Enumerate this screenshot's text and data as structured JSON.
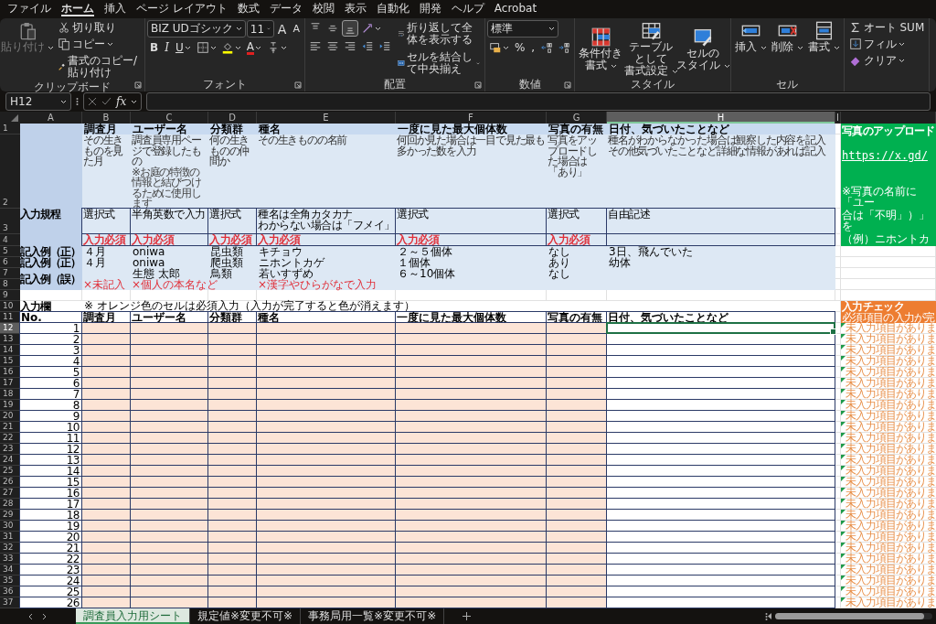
{
  "menu": [
    {
      "label": "ファイル",
      "selected": false
    },
    {
      "label": "ホーム",
      "selected": true
    },
    {
      "label": "挿入",
      "selected": false
    },
    {
      "label": "ページ レイアウト",
      "selected": false
    },
    {
      "label": "数式",
      "selected": false
    },
    {
      "label": "データ",
      "selected": false
    },
    {
      "label": "校閲",
      "selected": false
    },
    {
      "label": "表示",
      "selected": false
    },
    {
      "label": "自動化",
      "selected": false
    },
    {
      "label": "開発",
      "selected": false
    },
    {
      "label": "ヘルプ",
      "selected": false
    },
    {
      "label": "Acrobat",
      "selected": false
    }
  ],
  "ribbon": {
    "groups": [
      {
        "label": "クリップボード",
        "launcher": true,
        "blocks": [
          [
            [
              {
                "kind": "large",
                "lines": [
                  "貼り付け"
                ],
                "disabled": true,
                "menu": true
              }
            ]
          ],
          [
            [
              {
                "kind": "small",
                "label": "切り取り"
              }
            ],
            [
              {
                "kind": "small",
                "label": "コピー",
                "menu": true
              }
            ],
            [
              {
                "kind": "small",
                "label": "書式のコピー/貼り付け"
              }
            ]
          ]
        ]
      },
      {
        "label": "フォント",
        "launcher": true,
        "blocks": [
          [
            [
              {
                "kind": "wide_field",
                "value": "BIZ UDゴシック",
                "menu": true
              },
              {
                "kind": "narrow_field",
                "value": "11",
                "menu": true
              },
              {
                "kind": "grow",
                "label": "A"
              },
              {
                "kind": "shrink",
                "label": "A"
              }
            ],
            [
              {
                "kind": "bold",
                "label": "B"
              },
              {
                "kind": "italic",
                "label": "I"
              },
              {
                "kind": "underline",
                "label": "U",
                "menu": true
              },
              {
                "kind": "icon",
                "menu": true
              },
              {
                "kind": "icon",
                "menu": true
              },
              {
                "kind": "font_color",
                "label": "A",
                "menu": true
              },
              {
                "kind": "icon",
                "menu": true
              }
            ]
          ]
        ]
      },
      {
        "label": "配置",
        "launcher": true,
        "blocks": [
          [
            [
              {
                "kind": "icon",
                "selected": false
              },
              {
                "kind": "icon",
                "selected": false
              },
              {
                "kind": "icon",
                "selected": true
              },
              {
                "kind": "icon",
                "menu": true,
                "selected": false
              }
            ],
            [
              {
                "kind": "icon",
                "selected": false
              },
              {
                "kind": "icon",
                "selected": false
              },
              {
                "kind": "icon",
                "selected": false
              },
              {
                "kind": "icon",
                "selected": false
              },
              {
                "kind": "icon",
                "selected": false
              }
            ]
          ],
          [
            [
              {
                "kind": "small",
                "label": "折り返して全体を表示する"
              }
            ],
            [
              {
                "kind": "small",
                "label": "セルを結合して中央揃え",
                "menu": true
              }
            ]
          ]
        ]
      },
      {
        "label": "数値",
        "launcher": true,
        "blocks": [
          [
            [
              {
                "kind": "wide_field",
                "value": "標準",
                "menu": true
              }
            ],
            [
              {
                "kind": "icon",
                "menu": true
              },
              {
                "kind": "glyph",
                "label": "%"
              },
              {
                "kind": "glyph",
                "label": ","
              },
              {
                "kind": "icon"
              },
              {
                "kind": "icon"
              }
            ]
          ]
        ]
      },
      {
        "label": "スタイル",
        "blocks": [
          [
            [
              {
                "kind": "large",
                "lines": [
                  "条件付き",
                  "書式"
                ],
                "menu": true
              },
              {
                "kind": "large",
                "lines": [
                  "テーブルとして",
                  "書式設定"
                ],
                "menu": true
              },
              {
                "kind": "large",
                "lines": [
                  "セルの",
                  "スタイル"
                ],
                "menu": true
              }
            ]
          ]
        ]
      },
      {
        "label": "セル",
        "blocks": [
          [
            [
              {
                "kind": "large",
                "lines": [
                  "挿入"
                ],
                "menu": true
              },
              {
                "kind": "large",
                "lines": [
                  "削除"
                ],
                "menu": true
              },
              {
                "kind": "large",
                "lines": [
                  "書式"
                ],
                "menu": true
              }
            ]
          ]
        ]
      },
      {
        "blocks": [
          [
            [
              {
                "kind": "small",
                "label": "オート SUM"
              }
            ],
            [
              {
                "kind": "small",
                "label": "フィル",
                "menu": true
              }
            ],
            [
              {
                "kind": "small",
                "label": "クリア",
                "menu": true
              }
            ]
          ]
        ]
      }
    ]
  },
  "formula_bar": {
    "name_box": "H12",
    "fx": "fx"
  },
  "sheet": {
    "columns": [
      {
        "letter": "A",
        "selected": false
      },
      {
        "letter": "B",
        "selected": false
      },
      {
        "letter": "C",
        "selected": false
      },
      {
        "letter": "D",
        "selected": false
      },
      {
        "letter": "E",
        "selected": false
      },
      {
        "letter": "F",
        "selected": false
      },
      {
        "letter": "G",
        "selected": false
      },
      {
        "letter": "H",
        "selected": true
      },
      {
        "letter": "I",
        "selected": false
      }
    ],
    "rows": [
      {
        "label": "1",
        "selected": false
      },
      {
        "label": "2",
        "selected": false
      },
      {
        "label": "3",
        "selected": false
      },
      {
        "label": "4",
        "selected": false
      },
      {
        "label": "5",
        "selected": false
      },
      {
        "label": "6",
        "selected": false
      },
      {
        "label": "7",
        "selected": false
      },
      {
        "label": "8",
        "selected": false
      },
      {
        "label": "9",
        "selected": false
      },
      {
        "label": "10",
        "selected": false
      },
      {
        "label": "11",
        "selected": false
      },
      {
        "label": "12",
        "selected": true
      },
      {
        "label": "13",
        "selected": false
      },
      {
        "label": "14",
        "selected": false
      },
      {
        "label": "15",
        "selected": false
      },
      {
        "label": "16",
        "selected": false
      },
      {
        "label": "17",
        "selected": false
      },
      {
        "label": "18",
        "selected": false
      },
      {
        "label": "19",
        "selected": false
      },
      {
        "label": "20",
        "selected": false
      },
      {
        "label": "21",
        "selected": false
      },
      {
        "label": "22",
        "selected": false
      },
      {
        "label": "23",
        "selected": false
      },
      {
        "label": "24",
        "selected": false
      },
      {
        "label": "25",
        "selected": false
      },
      {
        "label": "26",
        "selected": false
      },
      {
        "label": "27",
        "selected": false
      },
      {
        "label": "28",
        "selected": false
      },
      {
        "label": "29",
        "selected": false
      },
      {
        "label": "30",
        "selected": false
      },
      {
        "label": "31",
        "selected": false
      },
      {
        "label": "32",
        "selected": false
      },
      {
        "label": "33",
        "selected": false
      },
      {
        "label": "34",
        "selected": false
      },
      {
        "label": "35",
        "selected": false
      },
      {
        "label": "36",
        "selected": false
      },
      {
        "label": "37",
        "selected": false
      }
    ],
    "field_headers": {
      "B": "調査月",
      "C": "ユーザー名",
      "D": "分類群",
      "E": "種名",
      "F": "一度に見た最大個体数",
      "G": "写真の有無",
      "H": "日付、気づいたことなど"
    },
    "descriptions": {
      "B": [
        "その生きものを見た月"
      ],
      "C": [
        "調査員専用ページで登録したもの"
      ],
      "D": [
        "何の生きものの仲間か"
      ],
      "E": [
        "その生きものの名前"
      ],
      "F": [
        "何回か見た場合は一目で見た最も多かった数を入力"
      ],
      "G": [
        "写真をアップロードした場合は「あり」"
      ],
      "H": [
        "種名がわからなかった場合は観察した内容を記入",
        "その他気づいたことなど詳細な情報があれば記入"
      ]
    },
    "notes": {
      "C": "※お庭の特徴の情報と結びつけるために使用します"
    },
    "rule_label": "入力規程",
    "rules": {
      "B": [
        "選択式"
      ],
      "C": [
        "半角英数で入力"
      ],
      "D": [
        "選択式"
      ],
      "E": [
        "種名は全角カタカナ",
        "わからない場合は「フメイ」"
      ],
      "F": [
        "選択式"
      ],
      "G": [
        "選択式"
      ],
      "H": [
        "自由記述"
      ]
    },
    "required": {
      "B": "入力必須",
      "C": "入力必須",
      "D": "入力必須",
      "E": "入力必須",
      "F": "入力必須",
      "G": "入力必須"
    },
    "examples": [
      {
        "label": "記入例（正）",
        "cells": {
          "B": "４月",
          "C": "oniwa",
          "D": "昆虫類",
          "E": "キチョウ",
          "F": "２～５個体",
          "G": "なし",
          "H": "3日、飛んでいた"
        }
      },
      {
        "label": "記入例（正）",
        "cells": {
          "B": "４月",
          "C": "oniwa",
          "D": "爬虫類",
          "E": "ニホントカゲ",
          "F": "１個体",
          "G": "あり",
          "H": "幼体"
        }
      },
      {
        "label": "記入例（誤）",
        "cells": {
          "C": "生態 太郎",
          "D": "鳥類",
          "E": "若いすずめ",
          "F": "６～10個体",
          "G": "なし"
        },
        "errors": {
          "B": "×未記入",
          "C": "×個人の本名など",
          "E": "×漢字やひらがなで入力"
        }
      }
    ],
    "input_label": "入力欄",
    "input_notice": "※ オレンジ色のセルは必須入力（入力が完了すると色が消えます）",
    "entry_headers": {
      "A": "No.",
      "B": "調査月",
      "C": "ユーザー名",
      "D": "分類群",
      "E": "種名",
      "F": "一度に見た最大個体数",
      "G": "写真の有無",
      "H": "日付、気づいたことなど"
    },
    "entries": [
      {
        "no": "1",
        "check": "未入力項目がありま",
        "selected": true
      },
      {
        "no": "2",
        "check": "未入力項目がありま",
        "selected": false
      },
      {
        "no": "3",
        "check": "未入力項目がありま",
        "selected": false
      },
      {
        "no": "4",
        "check": "未入力項目がありま",
        "selected": false
      },
      {
        "no": "5",
        "check": "未入力項目がありま",
        "selected": false
      },
      {
        "no": "6",
        "check": "未入力項目がありま",
        "selected": false
      },
      {
        "no": "7",
        "check": "未入力項目がありま",
        "selected": false
      },
      {
        "no": "8",
        "check": "未入力項目がありま",
        "selected": false
      },
      {
        "no": "9",
        "check": "未入力項目がありま",
        "selected": false
      },
      {
        "no": "10",
        "check": "未入力項目がありま",
        "selected": false
      },
      {
        "no": "11",
        "check": "未入力項目がありま",
        "selected": false
      },
      {
        "no": "12",
        "check": "未入力項目がありま",
        "selected": false
      },
      {
        "no": "13",
        "check": "未入力項目がありま",
        "selected": false
      },
      {
        "no": "14",
        "check": "未入力項目がありま",
        "selected": false
      },
      {
        "no": "15",
        "check": "未入力項目がありま",
        "selected": false
      },
      {
        "no": "16",
        "check": "未入力項目がありま",
        "selected": false
      },
      {
        "no": "17",
        "check": "未入力項目がありま",
        "selected": false
      },
      {
        "no": "18",
        "check": "未入力項目がありま",
        "selected": false
      },
      {
        "no": "19",
        "check": "未入力項目がありま",
        "selected": false
      },
      {
        "no": "20",
        "check": "未入力項目がありま",
        "selected": false
      },
      {
        "no": "21",
        "check": "未入力項目がありま",
        "selected": false
      },
      {
        "no": "22",
        "check": "未入力項目がありま",
        "selected": false
      },
      {
        "no": "23",
        "check": "未入力項目がありま",
        "selected": false
      },
      {
        "no": "24",
        "check": "未入力項目がありま",
        "selected": false
      },
      {
        "no": "25",
        "check": "未入力項目がありま",
        "selected": false
      },
      {
        "no": "26",
        "check": "未入力項目がありま",
        "selected": false
      }
    ],
    "upload_panel": {
      "title": "写真のアップロード",
      "link": "https://x.gd/",
      "lines": [
        "※写真の名前に「ユー",
        "合は「不明」）」を",
        "（例）ニホントカ"
      ]
    },
    "check_panel": {
      "title": "入力チェック",
      "subtitle": "必須項目の入力が完"
    }
  },
  "sheet_tabs": [
    {
      "label": "調査員入力用シート",
      "selected": true
    },
    {
      "label": "規定値※変更不可※",
      "selected": false
    },
    {
      "label": "事務局用一覧※変更不可※",
      "selected": false
    }
  ]
}
